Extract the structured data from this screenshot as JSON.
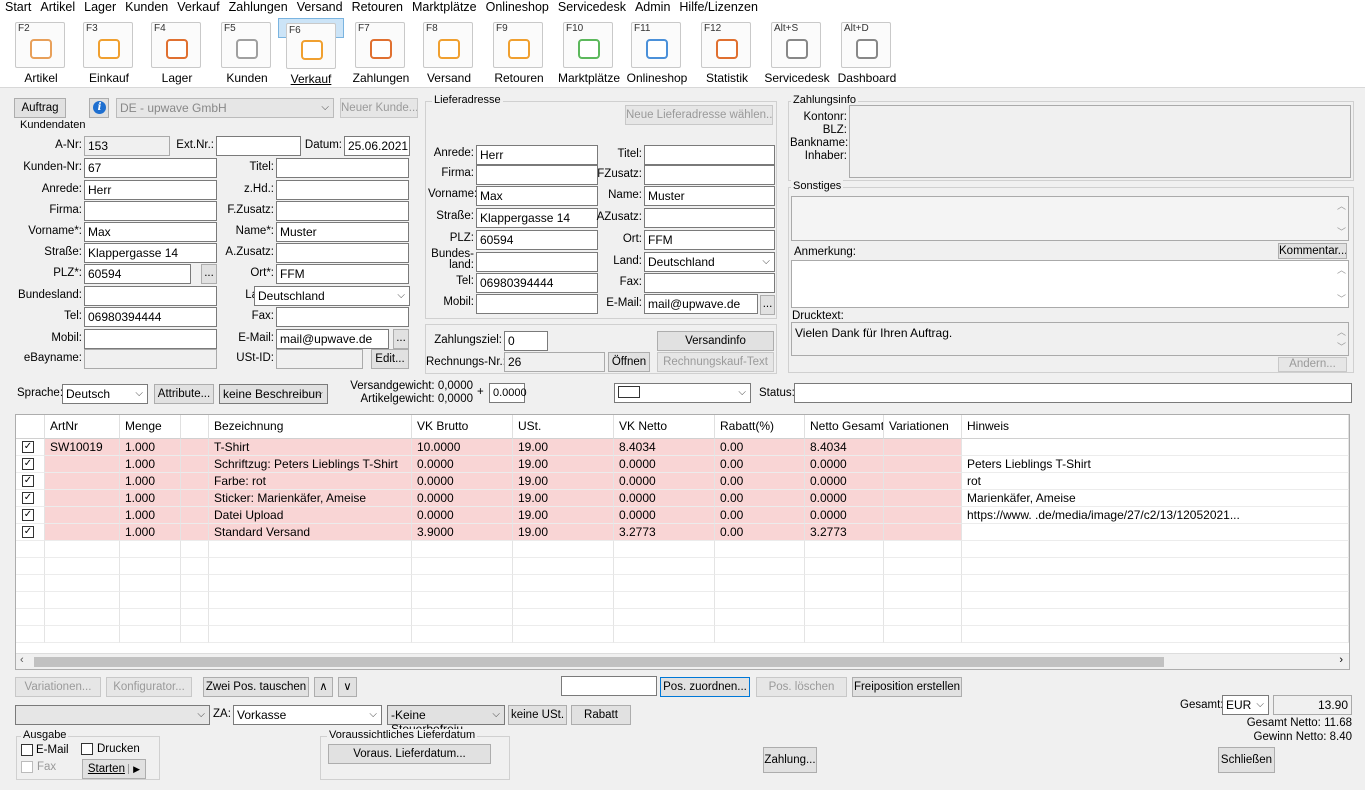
{
  "menu": [
    "Start",
    "Artikel",
    "Lager",
    "Kunden",
    "Verkauf",
    "Zahlungen",
    "Versand",
    "Retouren",
    "Marktplätze",
    "Onlineshop",
    "Servicedesk",
    "Admin",
    "Hilfe/Lizenzen"
  ],
  "toolbar": [
    {
      "key": "F2",
      "label": "Artikel",
      "icon": "artikel-icon"
    },
    {
      "key": "F3",
      "label": "Einkauf",
      "icon": "einkauf-icon"
    },
    {
      "key": "F4",
      "label": "Lager",
      "icon": "lager-icon"
    },
    {
      "key": "F5",
      "label": "Kunden",
      "icon": "kunden-icon"
    },
    {
      "key": "F6",
      "label": "Verkauf",
      "icon": "verkauf-icon"
    },
    {
      "key": "F7",
      "label": "Zahlungen",
      "icon": "zahlungen-icon"
    },
    {
      "key": "F8",
      "label": "Versand",
      "icon": "versand-icon"
    },
    {
      "key": "F9",
      "label": "Retouren",
      "icon": "retouren-icon"
    },
    {
      "key": "F10",
      "label": "Marktplätze",
      "icon": "marktplaetze-icon"
    },
    {
      "key": "F11",
      "label": "Onlineshop",
      "icon": "onlineshop-icon"
    },
    {
      "key": "F12",
      "label": "Statistik",
      "icon": "statistik-icon"
    },
    {
      "key": "Alt+S",
      "label": "Servicedesk",
      "icon": "servicedesk-icon"
    },
    {
      "key": "Alt+D",
      "label": "Dashboard",
      "icon": "dashboard-icon"
    }
  ],
  "top": {
    "auftrag": "Auftrag",
    "firma": "DE - upwave GmbH",
    "neuer_kunde": "Neuer Kunde..."
  },
  "kunden": {
    "title": "Kundendaten",
    "l_anr": "A-Nr:",
    "anr": "153",
    "l_extnr": "Ext.Nr.:",
    "extnr": "",
    "l_datum": "Datum:",
    "datum": "25.06.2021",
    "l_kundennr": "Kunden-Nr:",
    "kundennr": "67",
    "l_titel": "Titel:",
    "titel": "",
    "l_anrede": "Anrede:",
    "anrede": "Herr",
    "l_zhd": "z.Hd.:",
    "zhd": "",
    "l_firma": "Firma:",
    "firma": "",
    "l_fzusatz": "F.Zusatz:",
    "fzusatz": "",
    "l_vorname": "Vorname*:",
    "vorname": "Max",
    "l_name": "Name*:",
    "name": "Muster",
    "l_strasse": "Straße:",
    "strasse": "Klappergasse 14",
    "l_azusatz": "A.Zusatz:",
    "azusatz": "",
    "l_plz": "PLZ*:",
    "plz": "60594",
    "l_ort": "Ort*:",
    "ort": "FFM",
    "l_bundesland": "Bundesland:",
    "bundesland": "",
    "l_land": "Land:",
    "land": "Deutschland",
    "l_tel": "Tel:",
    "tel": "06980394444",
    "l_fax": "Fax:",
    "fax": "",
    "l_mobil": "Mobil:",
    "mobil": "",
    "l_email": "E-Mail:",
    "email": "mail@upwave.de",
    "l_ebayname": "eBayname:",
    "ebayname": "",
    "l_ustid": "USt-ID:",
    "ustid": "",
    "edit": "Edit..."
  },
  "liefer": {
    "title": "Lieferadresse",
    "neue": "Neue Lieferadresse wählen...",
    "l_anrede": "Anrede:",
    "anrede": "Herr",
    "l_titel": "Titel:",
    "titel": "",
    "l_firma": "Firma:",
    "firma": "",
    "l_fzusatz": "FZusatz:",
    "fzusatz": "",
    "l_vorname": "Vorname:",
    "vorname": "Max",
    "l_name": "Name:",
    "name": "Muster",
    "l_strasse": "Straße:",
    "strasse": "Klappergasse 14",
    "l_azusatz": "AZusatz:",
    "azusatz": "",
    "l_plz": "PLZ:",
    "plz": "60594",
    "l_ort": "Ort:",
    "ort": "FFM",
    "l_bundesland": "Bundes-\nland:",
    "bundesland": "",
    "l_land": "Land:",
    "land": "Deutschland",
    "l_tel": "Tel:",
    "tel": "06980394444",
    "l_fax": "Fax:",
    "fax": "",
    "l_mobil": "Mobil:",
    "mobil": "",
    "l_email": "E-Mail:",
    "email": "mail@upwave.de",
    "l_zahlungsziel": "Zahlungsziel:",
    "zahlungsziel": "0",
    "versandinfo": "Versandinfo",
    "l_rechnr": "Rechnungs-Nr.:",
    "rechnr": "26",
    "oeffnen": "Öffnen",
    "rechnungskauf": "Rechnungskauf-Text"
  },
  "zahlungsinfo": {
    "title": "Zahlungsinfo",
    "l_kontonr": "Kontonr:",
    "l_blz": "BLZ:",
    "l_bankname": "Bankname:",
    "l_inhaber": "Inhaber:"
  },
  "sonstiges": {
    "title": "Sonstiges",
    "anmerkung": "Anmerkung:",
    "kommentar": "Kommentar...",
    "drucktext": "Drucktext:",
    "drucktext_val": "Vielen Dank für Ihren Auftrag.",
    "aendern": "Ändern..."
  },
  "mid": {
    "l_sprache": "Sprache:",
    "sprache": "Deutsch",
    "attribute": "Attribute...",
    "beschreibung": "keine Beschreibun",
    "l_versandgewicht": "Versandgewicht:",
    "versandgewicht": "0,0000",
    "l_artikelgewicht": "Artikelgewicht:",
    "artikelgewicht": "0,0000",
    "plus": "+",
    "extra": "0.0000",
    "l_status": "Status:",
    "status": ""
  },
  "grid": {
    "headers": [
      "",
      "ArtNr",
      "Menge",
      "",
      "Bezeichnung",
      "VK Brutto",
      "USt.",
      "VK Netto",
      "Rabatt(%)",
      "Netto Gesamt",
      "Variationen",
      "Hinweis"
    ],
    "rows": [
      {
        "artnr": "SW10019",
        "menge": "1.000",
        "bez": "T-Shirt",
        "brutto": "10.0000",
        "ust": "19.00",
        "netto": "8.4034",
        "rabatt": "0.00",
        "gesamt": "8.4034",
        "hinweis": ""
      },
      {
        "artnr": "",
        "menge": "1.000",
        "bez": "Schriftzug: Peters Lieblings T-Shirt",
        "brutto": "0.0000",
        "ust": "19.00",
        "netto": "0.0000",
        "rabatt": "0.00",
        "gesamt": "0.0000",
        "hinweis": "Peters Lieblings T-Shirt"
      },
      {
        "artnr": "",
        "menge": "1.000",
        "bez": "Farbe: rot",
        "brutto": "0.0000",
        "ust": "19.00",
        "netto": "0.0000",
        "rabatt": "0.00",
        "gesamt": "0.0000",
        "hinweis": "rot"
      },
      {
        "artnr": "",
        "menge": "1.000",
        "bez": "Sticker: Marienkäfer, Ameise",
        "brutto": "0.0000",
        "ust": "19.00",
        "netto": "0.0000",
        "rabatt": "0.00",
        "gesamt": "0.0000",
        "hinweis": "Marienkäfer, Ameise"
      },
      {
        "artnr": "",
        "menge": "1.000",
        "bez": "Datei Upload",
        "brutto": "0.0000",
        "ust": "19.00",
        "netto": "0.0000",
        "rabatt": "0.00",
        "gesamt": "0.0000",
        "hinweis": "https://www.                    .de/media/image/27/c2/13/12052021..."
      },
      {
        "artnr": "",
        "menge": "1.000",
        "bez": "Standard Versand",
        "brutto": "3.9000",
        "ust": "19.00",
        "netto": "3.2773",
        "rabatt": "0.00",
        "gesamt": "3.2773",
        "hinweis": ""
      }
    ]
  },
  "actions": {
    "variationen": "Variationen...",
    "konfigurator": "Konfigurator...",
    "tauschen": "Zwei Pos. tauschen",
    "up": "∧",
    "down": "∨",
    "zuordnen": "Pos. zuordnen...",
    "loeschen": "Pos. löschen",
    "freiposition": "Freiposition erstellen"
  },
  "bottom": {
    "l_za": "ZA:",
    "za": "Vorkasse",
    "steuer": "-Keine Steuerbefreiu",
    "keine_ust": "keine USt.",
    "rabatt": "Rabatt",
    "l_gesamt": "Gesamt:",
    "currency": "EUR",
    "gesamt": "13.90",
    "gesamt_netto": "Gesamt Netto: 11.68",
    "gewinn_netto": "Gewinn Netto: 8.40",
    "ausgabe": "Ausgabe",
    "email": "E-Mail",
    "drucken": "Drucken",
    "fax": "Fax",
    "starten": "Starten",
    "liefer_title": "Voraussichtliches Lieferdatum",
    "liefer_btn": "Voraus. Lieferdatum...",
    "zahlung": "Zahlung...",
    "schliessen": "Schließen"
  }
}
